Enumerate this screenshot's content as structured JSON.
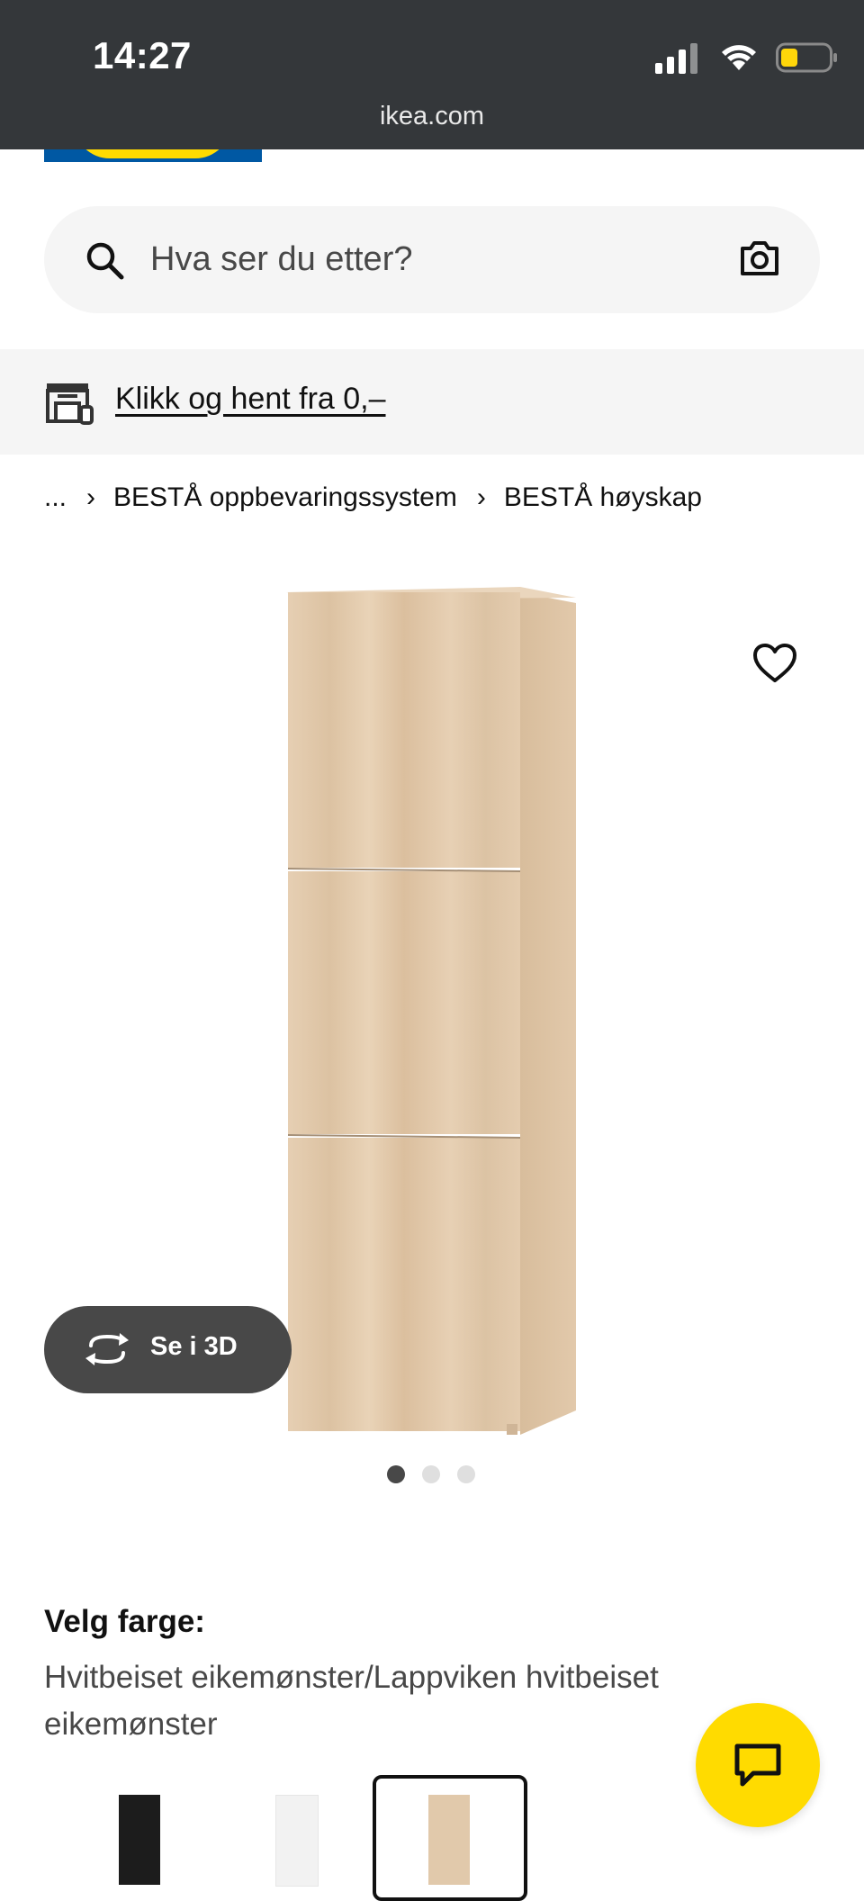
{
  "status_bar": {
    "time": "14:27",
    "url": "ikea.com"
  },
  "search": {
    "placeholder": "Hva ser du etter?"
  },
  "banner": {
    "text": "Klikk og hent fra 0,–"
  },
  "breadcrumb": {
    "ellipsis": "...",
    "items": [
      "BESTÅ oppbevaringssystem",
      "BESTÅ høyskap"
    ]
  },
  "product": {
    "view_3d_label": "Se i 3D",
    "image_count": 3,
    "active_image": 1
  },
  "color": {
    "title": "Velg farge:",
    "value": "Hvitbeiset eikemønster/Lappviken hvitbeiset eikemønster",
    "swatches": [
      {
        "name": "black",
        "color": "#1c1c1c"
      },
      {
        "name": "white",
        "color": "#f2f2f2"
      },
      {
        "name": "white-stained-oak",
        "color": "#e1c9ab",
        "selected": true
      }
    ]
  },
  "colors": {
    "status_bar": "#34373a",
    "ikea_blue": "#0058a3",
    "ikea_yellow": "#ffdb00",
    "dark_button": "#484848"
  }
}
